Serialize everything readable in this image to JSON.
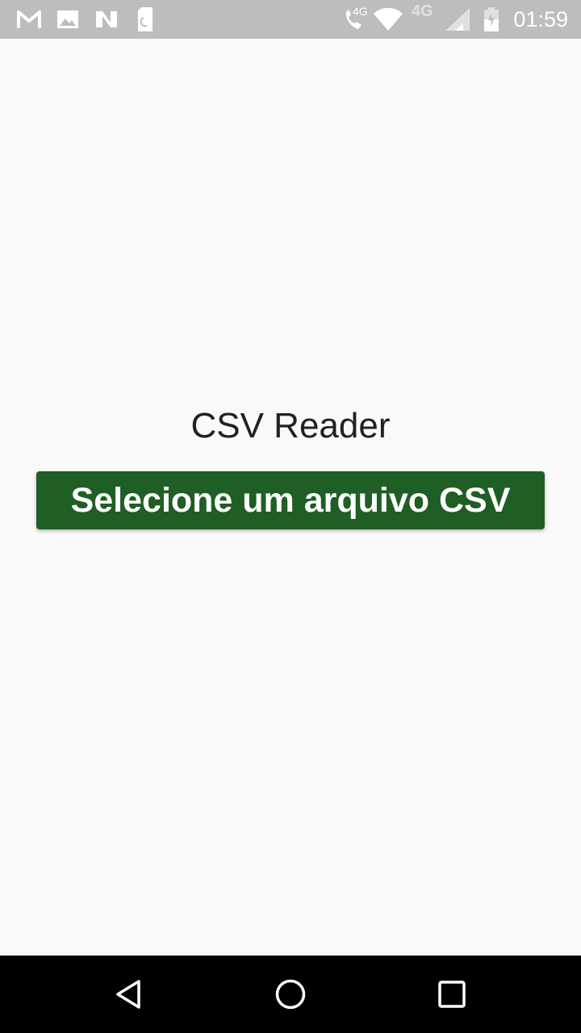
{
  "status_bar": {
    "time": "01:59",
    "network_label_1": "4G",
    "network_label_2": "4G",
    "icons": [
      "gmail-icon",
      "gallery-icon",
      "nfc-app-icon",
      "sim-card-icon",
      "volte-call-icon",
      "wifi-icon",
      "cellular-signal-icon",
      "battery-icon"
    ]
  },
  "app": {
    "title": "CSV Reader",
    "select_button_label": "Selecione um arquivo CSV"
  },
  "colors": {
    "button_bg": "#1f5e24",
    "background": "#f9f9f9",
    "status_bar": "#bdbdbd",
    "nav_bar": "#000000"
  },
  "nav_bar": {
    "buttons": [
      "back-icon",
      "home-icon",
      "recents-icon"
    ]
  }
}
